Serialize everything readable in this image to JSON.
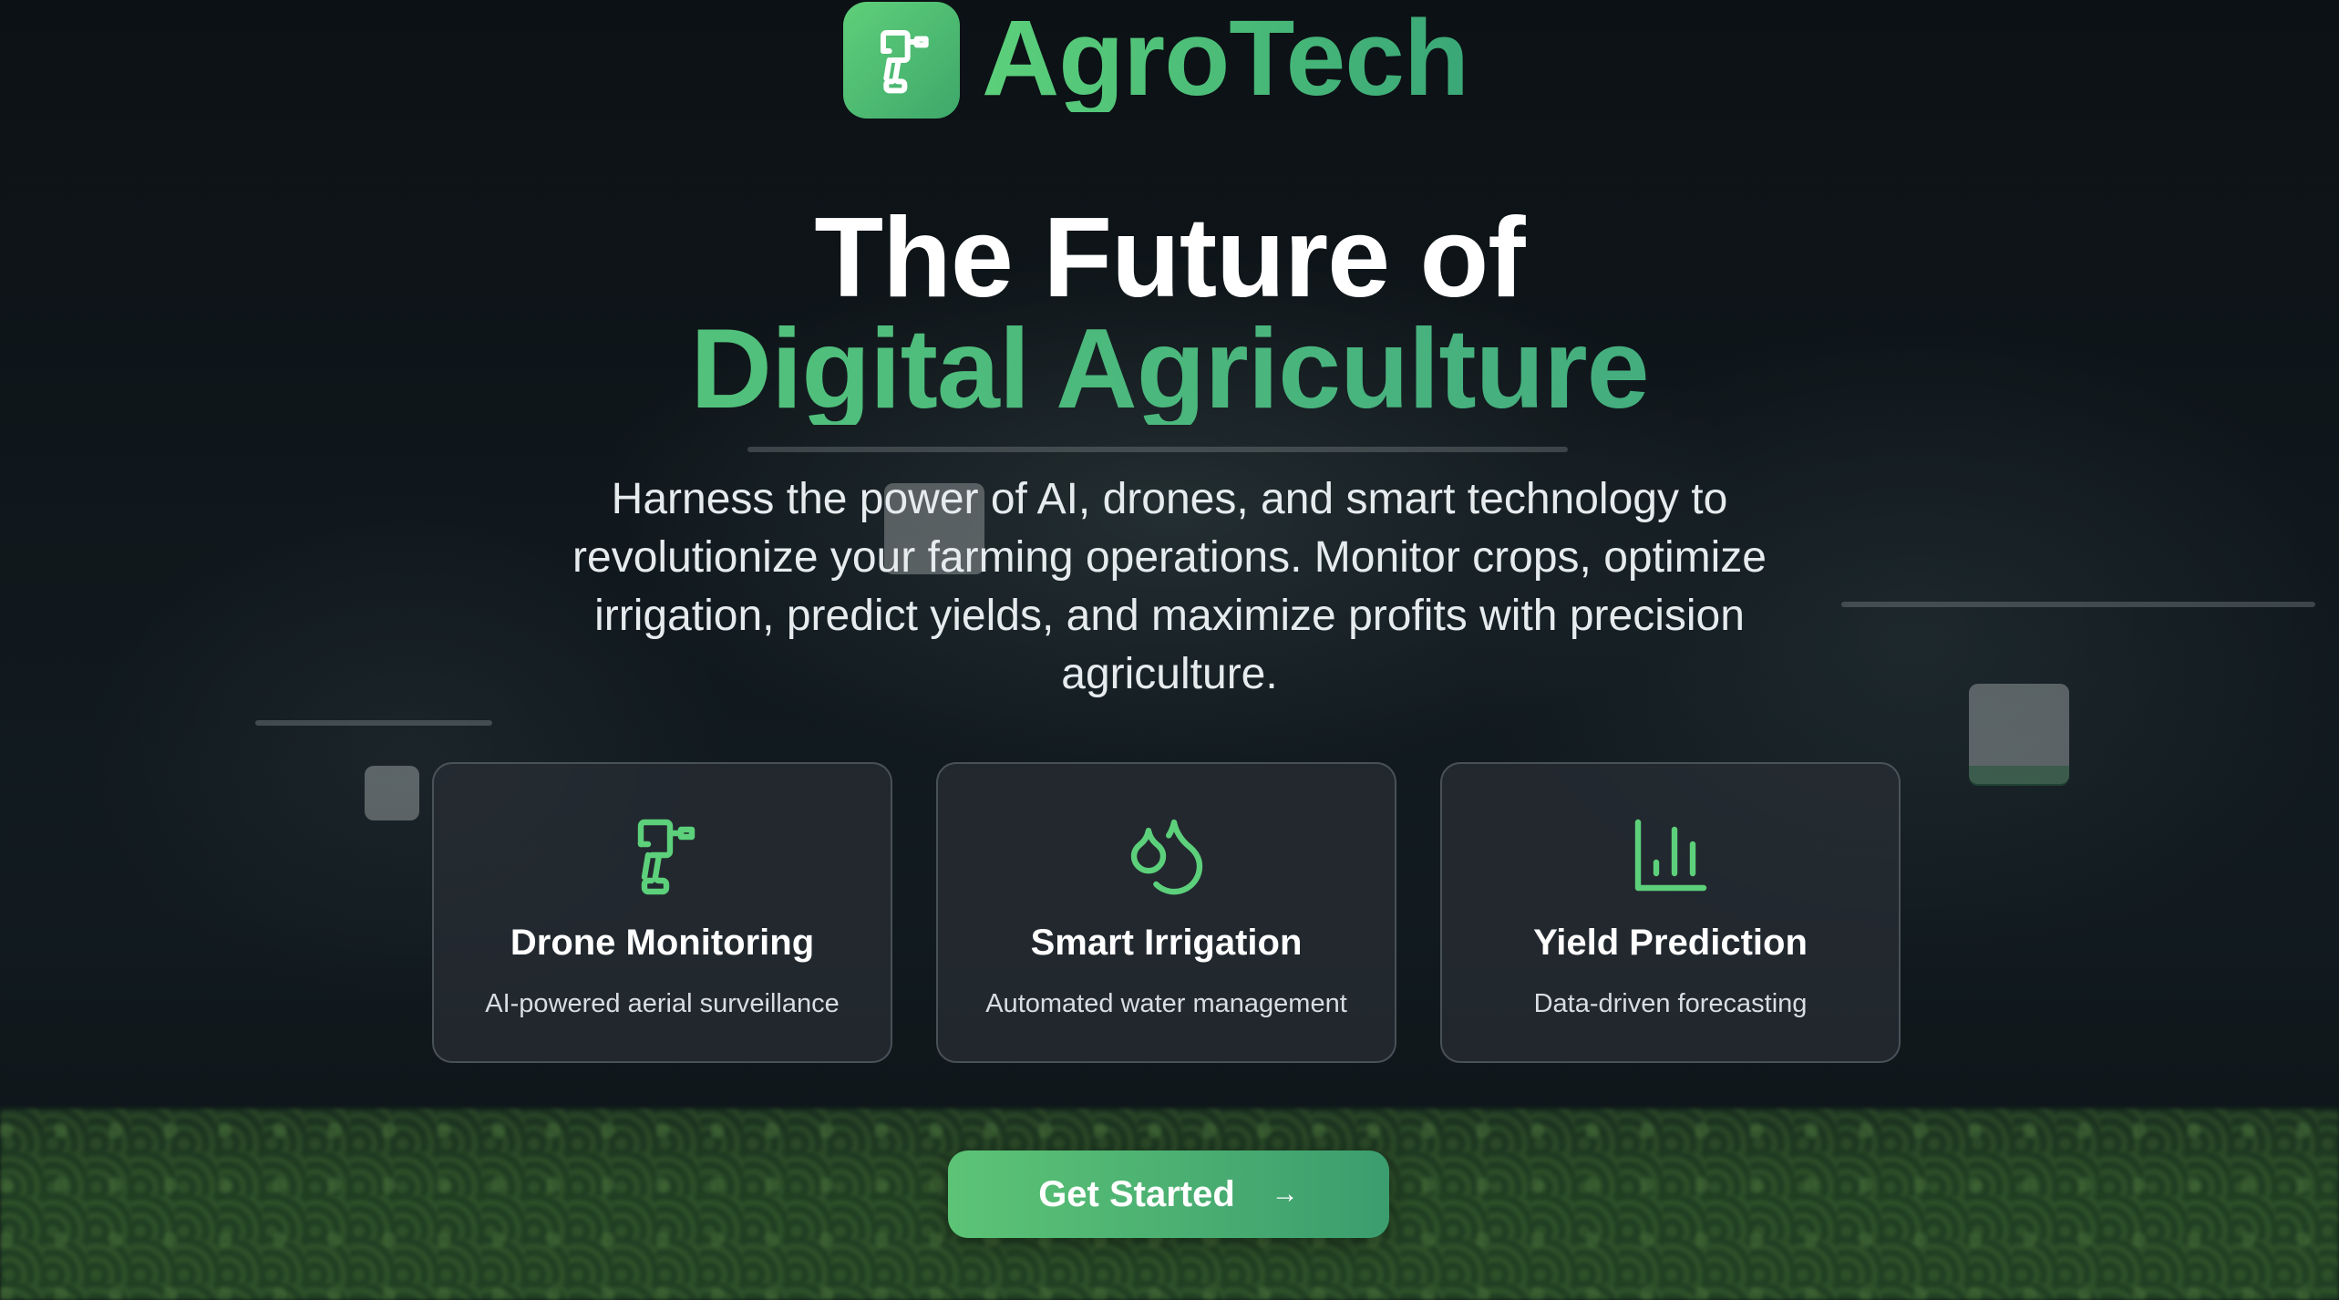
{
  "brand": {
    "name": "AgroTech",
    "logo_icon": "drill-drone-icon"
  },
  "hero": {
    "title_line1": "The Future of",
    "title_line2": "Digital Agriculture",
    "subtitle": "Harness the power of AI, drones, and smart technology to revolutionize your farming operations. Monitor crops, optimize irrigation, predict yields, and maximize profits with precision agriculture."
  },
  "features": [
    {
      "icon": "drone-monitoring-icon",
      "title": "Drone Monitoring",
      "description": "AI-powered aerial surveillance"
    },
    {
      "icon": "droplets-icon",
      "title": "Smart Irrigation",
      "description": "Automated water management"
    },
    {
      "icon": "bar-chart-icon",
      "title": "Yield Prediction",
      "description": "Data-driven forecasting"
    }
  ],
  "cta": {
    "label": "Get Started",
    "arrow": "→"
  },
  "colors": {
    "accent": "#5cd07a",
    "accent_dark": "#3aa777",
    "background": "#0f1418",
    "card_bg": "#282e34"
  }
}
